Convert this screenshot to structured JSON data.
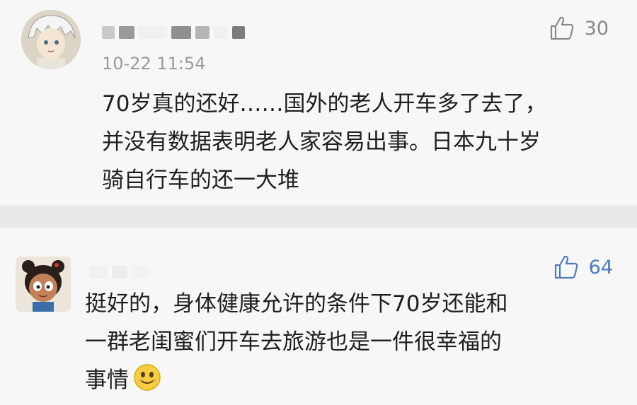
{
  "comments": [
    {
      "timestamp": "10-22 11:54",
      "likes": "30",
      "text": "70岁真的还好……国外的老人开车多了去了，\n并没有数据表明老人家容易出事。日本九十岁\n骑自行车的还一大堆",
      "like_color": "#8a8a8a"
    },
    {
      "likes": "64",
      "text": "挺好的，身体健康允许的条件下70岁还能和\n一群老闺蜜们开车去旅游也是一件很幸福的\n事情",
      "emoji": "smile-emoji",
      "like_color": "#4a7bc4"
    }
  ],
  "icons": {
    "like": "thumbs-up-icon",
    "avatar1": "anime-boy-avatar",
    "avatar2": "cartoon-girl-avatar"
  }
}
